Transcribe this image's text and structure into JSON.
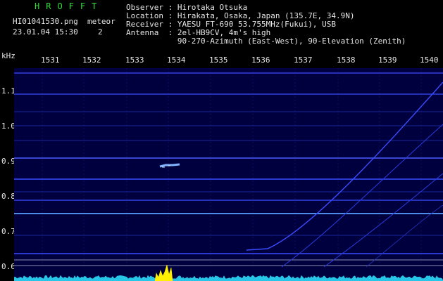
{
  "header": {
    "brand": "HROFFT",
    "filename": "HI01041530.png",
    "datetime": "23.01.04 15:30",
    "meteor_label": "meteor",
    "meteor_count": "2"
  },
  "info": {
    "observer": "Observer : Hirotaka Otsuka",
    "location": "Location : Hirakata, Osaka, Japan (135.7E, 34.9N)",
    "receiver": "Receiver : YAESU FT-690 53.755MHz(Fukui), USB",
    "antenna": "Antenna  : 2el-HB9CV, 4m's high",
    "antenna2": "           90-270-Azimuth (East-West), 90-Elevation (Zenith)"
  },
  "axis": {
    "unit": "kHz",
    "time_ticks": [
      "1531",
      "1532",
      "1533",
      "1534",
      "1535",
      "1536",
      "1537",
      "1538",
      "1539",
      "1540"
    ],
    "freq_ticks": [
      "1.1",
      "1.0",
      "0.9",
      "0.8",
      "0.7",
      "0.6"
    ]
  },
  "colors": {
    "background": "#000000",
    "plot_bg": "#00003e",
    "brand_green": "#2fdc3a",
    "line_blue": "#3a4cff",
    "line_bright": "#5aa0ff",
    "spectrum_cyan": "#27c6e8",
    "spectrum_yellow": "#ffef00"
  }
}
